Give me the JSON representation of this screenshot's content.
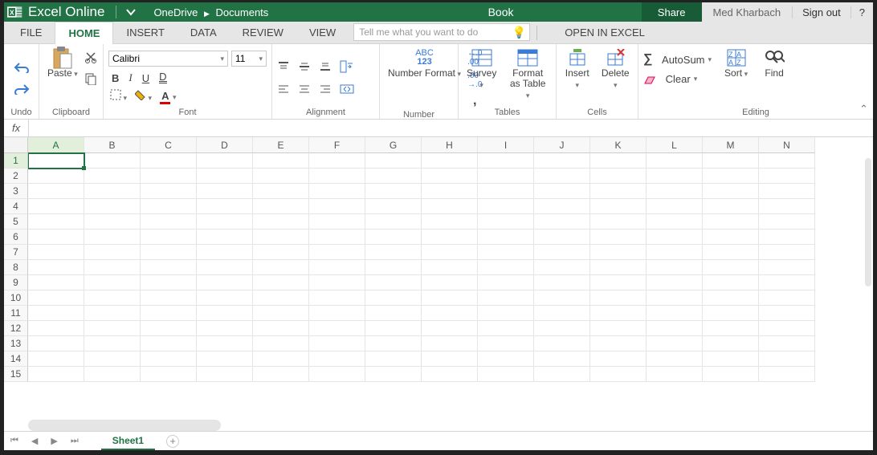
{
  "titlebar": {
    "app_name": "Excel Online",
    "breadcrumb_root": "OneDrive",
    "breadcrumb_folder": "Documents",
    "doc_title": "Book",
    "share": "Share",
    "user": "Med Kharbach",
    "signout": "Sign out",
    "help": "?"
  },
  "tabs": {
    "file": "FILE",
    "home": "HOME",
    "insert": "INSERT",
    "data": "DATA",
    "review": "REVIEW",
    "view": "VIEW",
    "tellme_placeholder": "Tell me what you want to do",
    "open_in_excel": "OPEN IN EXCEL"
  },
  "ribbon": {
    "undo_group": "Undo",
    "clipboard_group": "Clipboard",
    "paste": "Paste",
    "font_group": "Font",
    "font_name": "Calibri",
    "font_size": "11",
    "alignment_group": "Alignment",
    "number_group": "Number",
    "number_format": "Number Format",
    "tables_group": "Tables",
    "survey": "Survey",
    "format_as_table": "Format as Table",
    "cells_group": "Cells",
    "insert": "Insert",
    "delete": "Delete",
    "editing_group": "Editing",
    "autosum": "AutoSum",
    "clear": "Clear",
    "sort": "Sort",
    "find": "Find"
  },
  "formulabar": {
    "fx": "fx"
  },
  "grid": {
    "columns": [
      "A",
      "B",
      "C",
      "D",
      "E",
      "F",
      "G",
      "H",
      "I",
      "J",
      "K",
      "L",
      "M",
      "N"
    ],
    "rows": [
      "1",
      "2",
      "3",
      "4",
      "5",
      "6",
      "7",
      "8",
      "9",
      "10",
      "11",
      "12",
      "13",
      "14",
      "15"
    ],
    "selected_col": "A",
    "selected_row": "1"
  },
  "sheetbar": {
    "sheet1": "Sheet1"
  }
}
